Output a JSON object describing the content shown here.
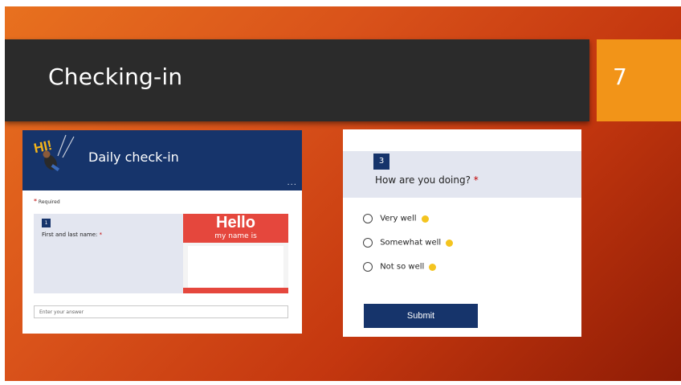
{
  "slide": {
    "title": "Checking-in",
    "number": "7",
    "colors": {
      "title_bar": "#2b2b2b",
      "number_box": "#f29418",
      "form_accent": "#16346b"
    }
  },
  "left_form": {
    "logo_icon": "hi-waving-person-icon",
    "logo_text": "HI!",
    "title": "Daily check-in",
    "menu": "...",
    "required_star": "*",
    "required_label": "Required",
    "question": {
      "number": "1",
      "text": "First and last name:",
      "star": "*"
    },
    "hello_sticker": {
      "hello": "Hello",
      "subtitle": "my name is"
    },
    "answer_placeholder": "Enter your answer"
  },
  "right_form": {
    "question": {
      "number": "3",
      "text": "How are you doing?",
      "star": "*"
    },
    "options": [
      {
        "label": "Very well",
        "emoji": "smiling-face-icon"
      },
      {
        "label": "Somewhat well",
        "emoji": "slightly-smiling-face-icon"
      },
      {
        "label": "Not so well",
        "emoji": "pensive-face-icon"
      }
    ],
    "submit_label": "Submit"
  }
}
